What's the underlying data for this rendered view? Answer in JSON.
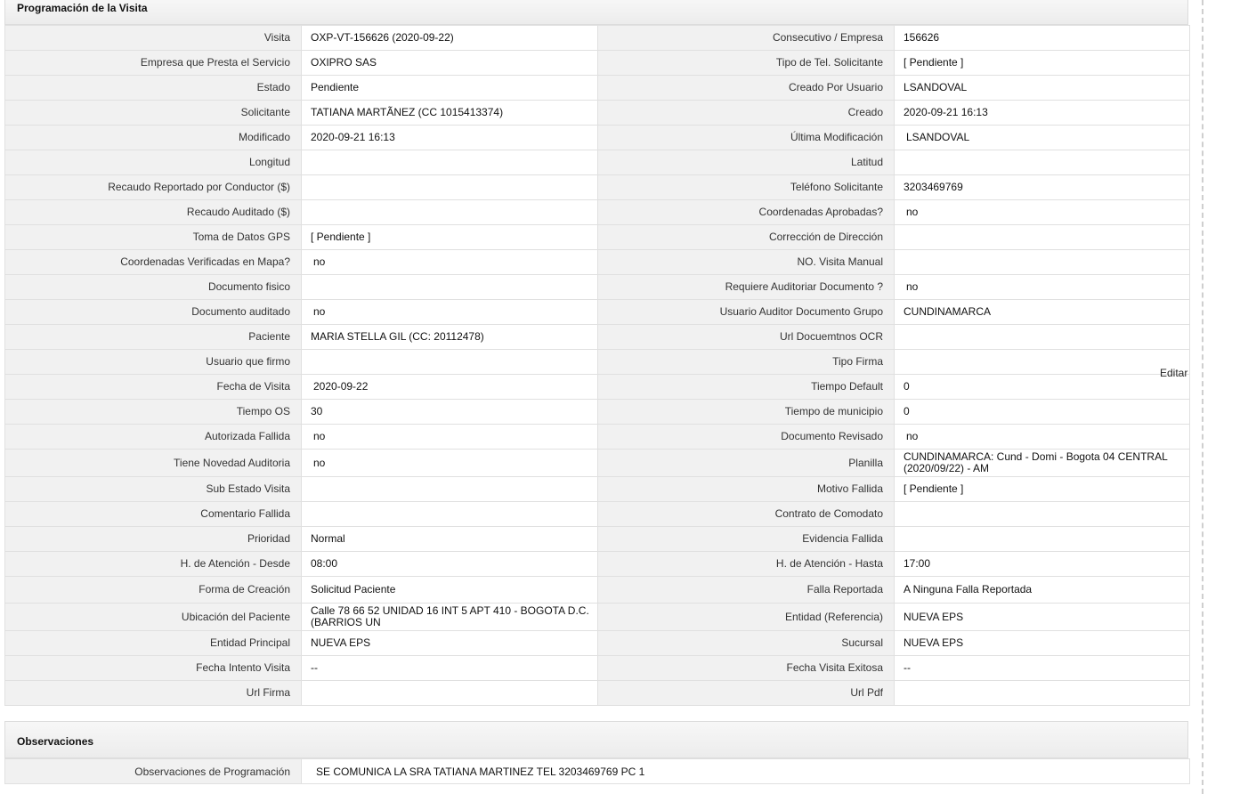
{
  "section1": {
    "title": "Programación de la Visita",
    "edit_label": "Editar",
    "rows": [
      {
        "l1": "Visita",
        "v1": "OXP-VT-156626 (2020-09-22)",
        "l2": "Consecutivo / Empresa",
        "v2": "156626"
      },
      {
        "l1": "Empresa que Presta el Servicio",
        "v1": "OXIPRO SAS",
        "l2": "Tipo de Tel. Solicitante",
        "v2": "[ Pendiente ]"
      },
      {
        "l1": "Estado",
        "v1": "Pendiente",
        "l2": "Creado Por Usuario",
        "v2": "LSANDOVAL"
      },
      {
        "l1": "Solicitante",
        "v1": "TATIANA MARTÃNEZ (CC 1015413374)",
        "l2": "Creado",
        "v2": "2020-09-21 16:13"
      },
      {
        "l1": "Modificado",
        "v1": "2020-09-21 16:13",
        "l2": "Última Modificación",
        "v2": "LSANDOVAL"
      },
      {
        "l1": "Longitud",
        "v1": "",
        "l2": "Latitud",
        "v2": ""
      },
      {
        "l1": "Recaudo Reportado por Conductor ($)",
        "v1": "",
        "l2": "Teléfono Solicitante",
        "v2": "3203469769"
      },
      {
        "l1": "Recaudo Auditado ($)",
        "v1": "",
        "l2": "Coordenadas Aprobadas?",
        "v2": "no"
      },
      {
        "l1": "Toma de Datos GPS",
        "v1": "[ Pendiente ]",
        "l2": "Corrección de Dirección",
        "v2": ""
      },
      {
        "l1": "Coordenadas Verificadas en Mapa?",
        "v1": "no",
        "l2": "NO. Visita Manual",
        "v2": ""
      },
      {
        "l1": "Documento fisico",
        "v1": "",
        "l2": "Requiere Auditoriar Documento ?",
        "v2": "no"
      },
      {
        "l1": "Documento auditado",
        "v1": "no",
        "l2": "Usuario Auditor Documento Grupo",
        "v2": "CUNDINAMARCA"
      },
      {
        "l1": "Paciente",
        "v1": "MARIA STELLA GIL (CC: 20112478)",
        "l2": "Url Docuemtnos OCR",
        "v2": ""
      },
      {
        "l1": "Usuario que firmo",
        "v1": "",
        "l2": "Tipo Firma",
        "v2": ""
      },
      {
        "l1": "Fecha de Visita",
        "v1": "2020-09-22",
        "l2": "Tiempo Default",
        "v2": "0"
      },
      {
        "l1": "Tiempo OS",
        "v1": "30",
        "l2": "Tiempo de municipio",
        "v2": "0"
      },
      {
        "l1": "Autorizada Fallida",
        "v1": "no",
        "l2": "Documento Revisado",
        "v2": "no"
      },
      {
        "l1": "Tiene Novedad Auditoria",
        "v1": "no",
        "l2": "Planilla",
        "v2": "CUNDINAMARCA: Cund - Domi - Bogota 04 CENTRAL (2020/09/22) - AM"
      },
      {
        "l1": "Sub Estado Visita",
        "v1": "",
        "l2": "Motivo Fallida",
        "v2": "[ Pendiente ]"
      },
      {
        "l1": "Comentario Fallida",
        "v1": "",
        "l2": "Contrato de Comodato",
        "v2": ""
      },
      {
        "l1": "Prioridad",
        "v1": "Normal",
        "l2": "Evidencia Fallida",
        "v2": ""
      },
      {
        "l1": "H. de Atención - Desde",
        "v1": "08:00",
        "l2": "H. de Atención - Hasta",
        "v2": "17:00"
      },
      {
        "l1": "Forma de Creación",
        "v1": "Solicitud Paciente",
        "l2": "Falla Reportada",
        "v2": "A Ninguna Falla Reportada"
      },
      {
        "l1": "Ubicación del Paciente",
        "v1": "Calle 78 66 52 UNIDAD 16 INT 5 APT 410 - BOGOTA D.C. (BARRIOS UN",
        "l2": "Entidad (Referencia)",
        "v2": "NUEVA EPS"
      },
      {
        "l1": "Entidad Principal",
        "v1": "NUEVA EPS",
        "l2": "Sucursal",
        "v2": "NUEVA EPS"
      },
      {
        "l1": "Fecha Intento Visita",
        "v1": "--",
        "l2": "Fecha Visita Exitosa",
        "v2": "--"
      },
      {
        "l1": "Url Firma",
        "v1": "",
        "l2": "Url Pdf",
        "v2": ""
      }
    ]
  },
  "section2": {
    "title": "Observaciones",
    "label": "Observaciones de Programación",
    "value": "SE COMUNICA LA SRA TATIANA MARTINEZ TEL 3203469769 PC 1"
  }
}
